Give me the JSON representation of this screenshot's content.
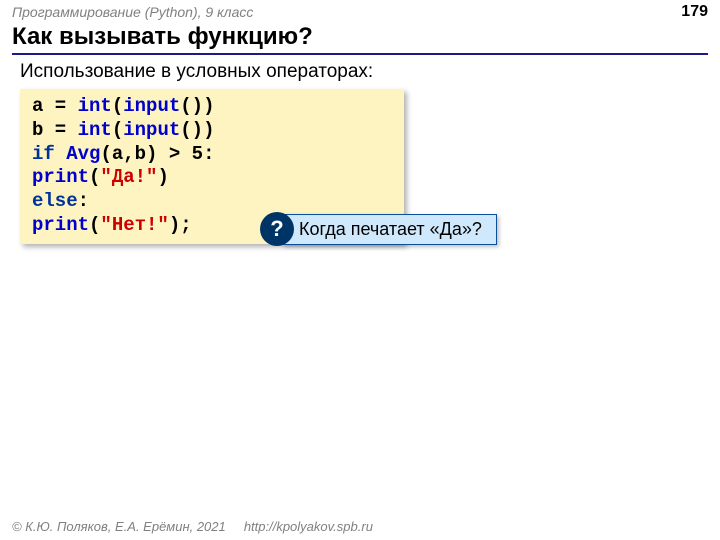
{
  "header": {
    "course": "Программирование (Python), 9 класс",
    "page_number": "179"
  },
  "title": "Как вызывать функцию?",
  "subtitle": "Использование в условных операторах:",
  "code": {
    "l1_a": "a",
    "l1_eq": " = ",
    "l1_int": "int",
    "l1_p1": "(",
    "l1_input": "input",
    "l1_p2": "())",
    "l2_b": "b",
    "l2_eq": " = ",
    "l2_int": "int",
    "l2_p1": "(",
    "l2_input": "input",
    "l2_p2": "())",
    "l3_if": "if",
    "l3_sp": " ",
    "l3_avg": "Avg",
    "l3_args": "(a,b)",
    "l3_gt": " > ",
    "l3_five": "5",
    "l3_colon": ":",
    "l4_indent": "  ",
    "l4_print": "print",
    "l4_p1": "(",
    "l4_str": "\"Да!\"",
    "l4_p2": ")",
    "l5_else": "else",
    "l5_colon": ":",
    "l6_indent": "  ",
    "l6_print": "print",
    "l6_p1": "(",
    "l6_str": "\"Нет!\"",
    "l6_p2": ");"
  },
  "callout": {
    "mark": "?",
    "text": "Когда печатает «Да»?"
  },
  "footer": {
    "copyright": "© К.Ю. Поляков, Е.А. Ерёмин, 2021",
    "url": "http://kpolyakov.spb.ru"
  }
}
